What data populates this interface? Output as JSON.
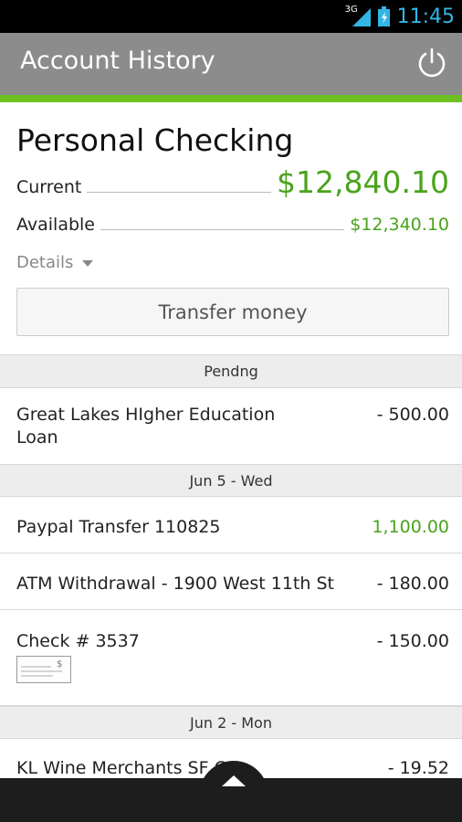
{
  "status_bar": {
    "network": "3G",
    "time": "11:45",
    "clock_color": "#33b5e5"
  },
  "app_bar": {
    "title": "Account History"
  },
  "account": {
    "name": "Personal Checking",
    "current_label": "Current",
    "current_value": "$12,840.10",
    "available_label": "Available",
    "available_value": "$12,340.10",
    "details_label": "Details",
    "balance_color": "#4aa31c"
  },
  "transfer_button": {
    "label": "Transfer money"
  },
  "sections": [
    {
      "header": "Pendng",
      "transactions": [
        {
          "description": "Great Lakes HIgher Education Loan",
          "amount": "- 500.00",
          "type": "debit"
        }
      ]
    },
    {
      "header": "Jun 5 - Wed",
      "transactions": [
        {
          "description": "Paypal Transfer 110825",
          "amount": "1,100.00",
          "type": "credit"
        },
        {
          "description": "ATM Withdrawal - 1900 West 11th St",
          "amount": "- 180.00",
          "type": "debit"
        },
        {
          "description": "Check # 3537",
          "amount": "- 150.00",
          "type": "debit",
          "icon": "check-image-icon"
        }
      ]
    },
    {
      "header": "Jun 2 - Mon",
      "transactions": [
        {
          "description": "KL Wine Merchants SF CA",
          "amount": "- 19.52",
          "type": "debit"
        }
      ]
    }
  ],
  "icons": {
    "power": "power-icon",
    "expand": "chevron-up-icon",
    "details": "caret-down-icon"
  }
}
